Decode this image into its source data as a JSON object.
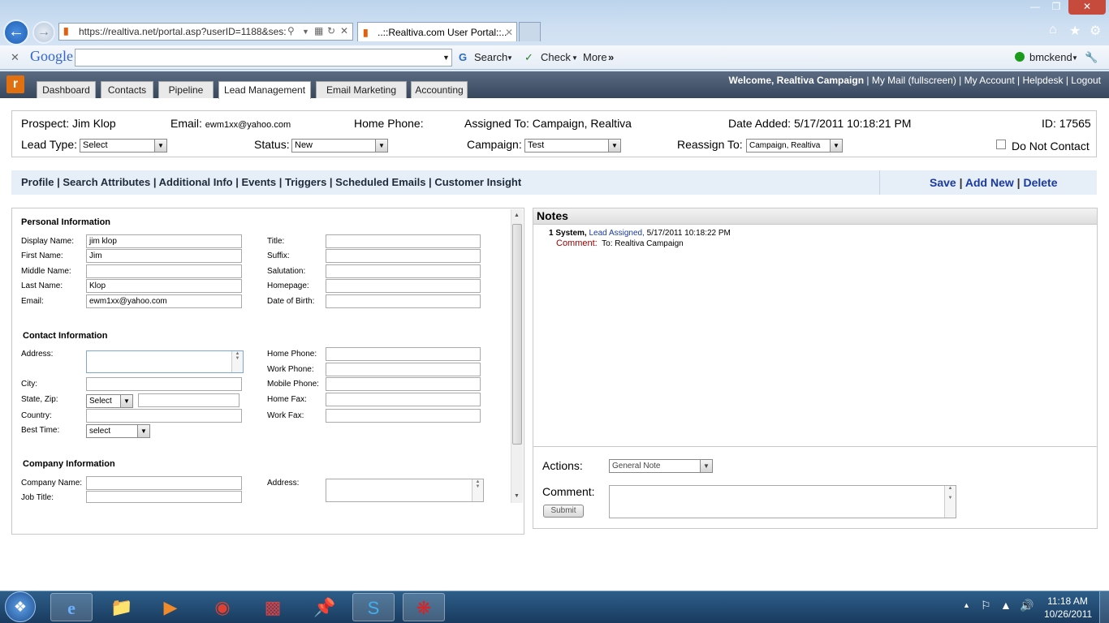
{
  "browser": {
    "url": "https://realtiva.net/portal.asp?userID=1188&ses:",
    "tabs": [
      {
        "label": "..::Realtiva.com User Portal::.."
      }
    ]
  },
  "google_toolbar": {
    "brand": "Google",
    "search_label": "Search",
    "check_label": "Check",
    "more_label": "More",
    "user": "bmckend"
  },
  "app": {
    "tabs": [
      "Dashboard",
      "Contacts",
      "Pipeline",
      "Lead Management",
      "Email Marketing",
      "Accounting"
    ],
    "active_tab": "Lead Management",
    "welcome": "Welcome, Realtiva Campaign",
    "links": [
      "My Mail (fullscreen)",
      "My Account",
      "Helpdesk",
      "Logout"
    ]
  },
  "lead": {
    "prospect_label": "Prospect:",
    "prospect": "Jim Klop",
    "email_label": "Email:",
    "email": "ewm1xx@yahoo.com",
    "home_phone_label": "Home Phone:",
    "assigned_label": "Assigned To:",
    "assigned": "Campaign, Realtiva",
    "date_label": "Date Added:",
    "date": "5/17/2011 10:18:21 PM",
    "id_label": "ID:",
    "id": "17565",
    "lead_type_label": "Lead Type:",
    "lead_type": "Select",
    "status_label": "Status:",
    "status": "New",
    "campaign_label": "Campaign:",
    "campaign": "Test",
    "reassign_label": "Reassign To:",
    "reassign": "Campaign, Realtiva",
    "dnc_label": "Do Not Contact"
  },
  "subnav": {
    "left": [
      "Profile",
      "Search Attributes",
      "Additional Info",
      "Events",
      "Triggers",
      "Scheduled Emails",
      "Customer Insight"
    ],
    "right": [
      "Save",
      "Add New",
      "Delete"
    ]
  },
  "personal": {
    "title": "Personal Information",
    "display_name_label": "Display Name:",
    "display_name": "jim klop",
    "first_name_label": "First Name:",
    "first_name": "Jim",
    "middle_name_label": "Middle Name:",
    "last_name_label": "Last Name:",
    "last_name": "Klop",
    "email_label": "Email:",
    "email": "ewm1xx@yahoo.com",
    "title_label": "Title:",
    "suffix_label": "Suffix:",
    "salutation_label": "Salutation:",
    "homepage_label": "Homepage:",
    "dob_label": "Date of Birth:"
  },
  "contact": {
    "title": "Contact Information",
    "address_label": "Address:",
    "city_label": "City:",
    "state_zip_label": "State, Zip:",
    "state": "Select",
    "country_label": "Country:",
    "best_time_label": "Best Time:",
    "best_time": "select",
    "home_phone_label": "Home Phone:",
    "work_phone_label": "Work Phone:",
    "mobile_phone_label": "Mobile Phone:",
    "home_fax_label": "Home Fax:",
    "work_fax_label": "Work Fax:"
  },
  "company": {
    "title": "Company Information",
    "company_name_label": "Company Name:",
    "job_title_label": "Job Title:",
    "address_label": "Address:"
  },
  "notes": {
    "title": "Notes",
    "entries": [
      {
        "num": "1",
        "author": "System,",
        "type": "Lead Assigned,",
        "date": "5/17/2011 10:18:22 PM",
        "comment_label": "Comment:",
        "comment": "To: Realtiva Campaign"
      }
    ],
    "actions_label": "Actions:",
    "action": "General Note",
    "comment_label": "Comment:",
    "submit": "Submit"
  },
  "taskbar": {
    "time": "11:18 AM",
    "date": "10/26/2011"
  },
  "colors": {
    "app_header": "#3f4f66",
    "link_blue": "#1a3aa0",
    "note_red": "#a00000",
    "subnav_bg": "#e6eef8"
  }
}
